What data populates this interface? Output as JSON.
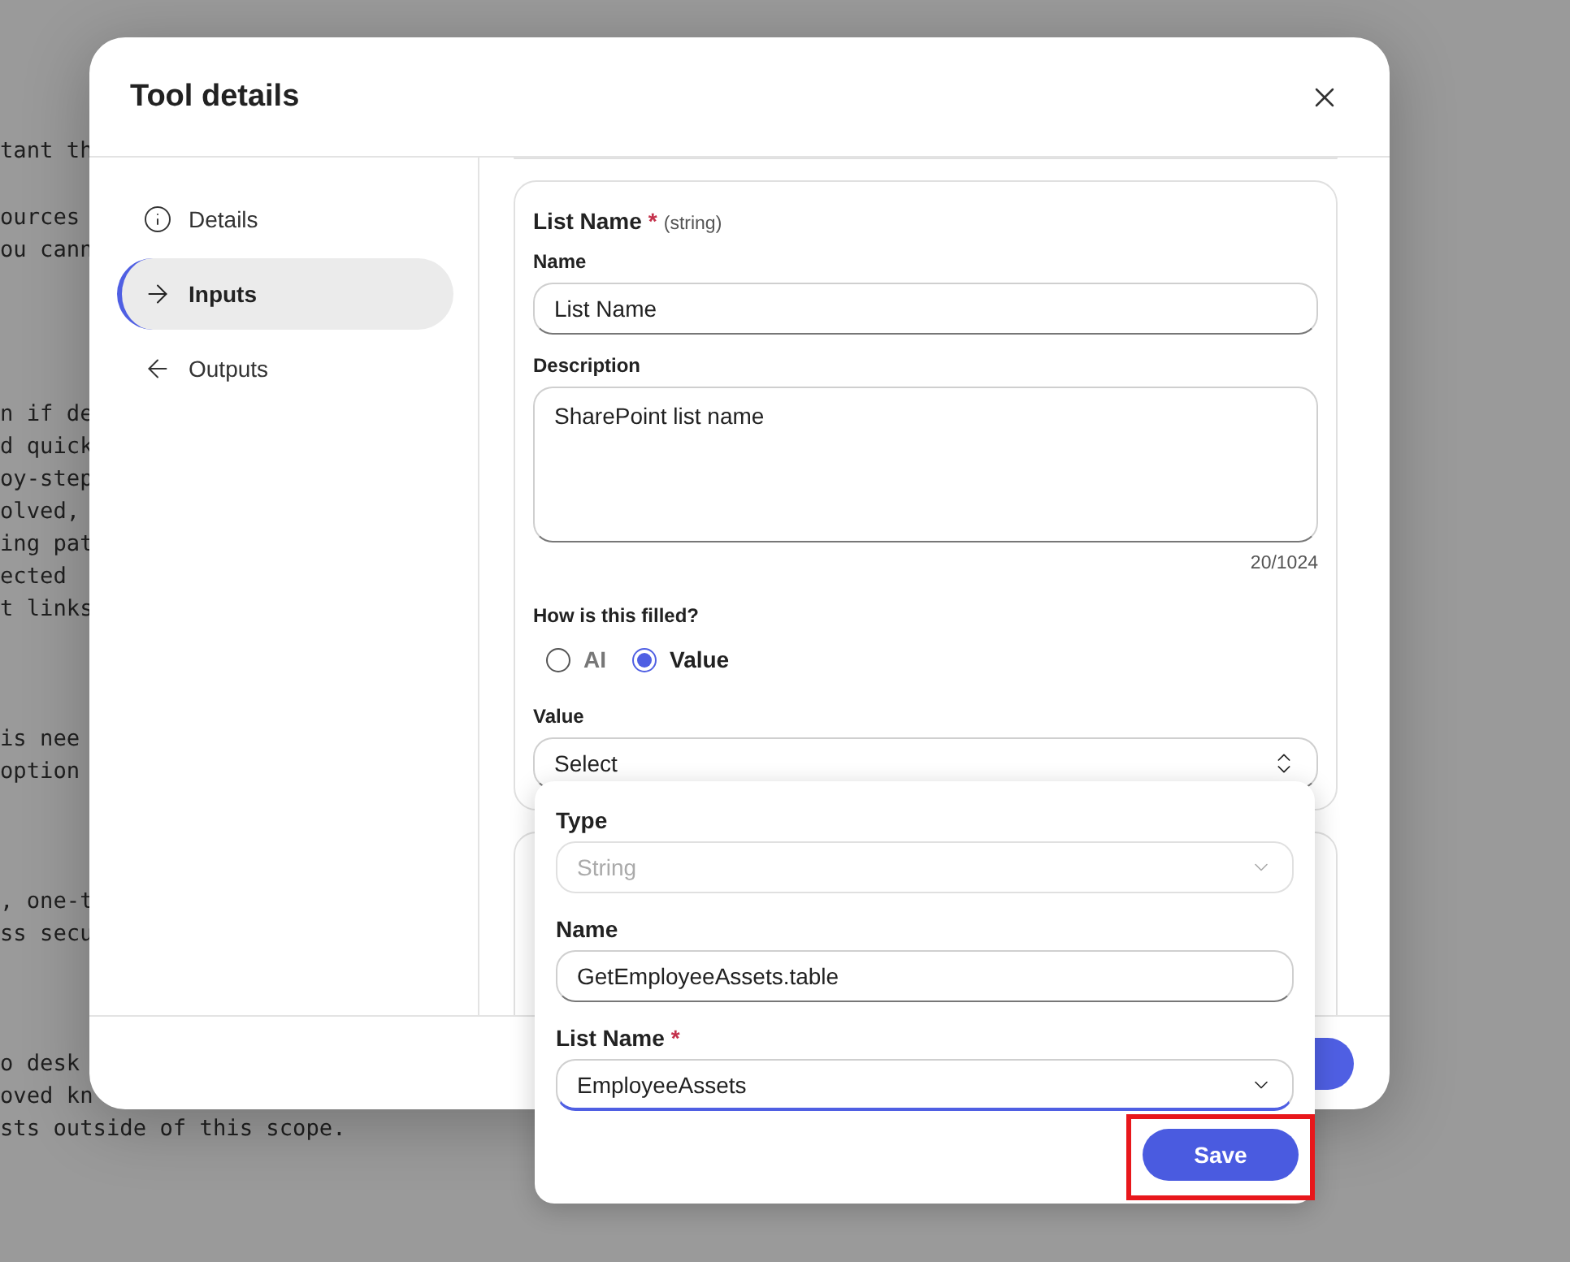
{
  "background_text": {
    "paragraphs": [
      [
        "tant th"
      ],
      [
        "ources",
        "ou cann"
      ],
      [
        "n if de",
        "d quick",
        "oy-step",
        "olved,",
        "ing pat",
        "ected",
        "t links"
      ],
      [
        "is nee",
        "option"
      ],
      [
        ", one-t",
        "ss secu"
      ],
      [
        "o desk",
        "oved kn",
        "sts outside of this scope."
      ]
    ]
  },
  "dialog": {
    "title": "Tool details",
    "sidebar": {
      "items": [
        {
          "kind": "info",
          "label": "Details",
          "selected": false
        },
        {
          "kind": "arrow-right",
          "label": "Inputs",
          "selected": true
        },
        {
          "kind": "arrow-left",
          "label": "Outputs",
          "selected": false
        }
      ]
    },
    "input_card": {
      "title": "List Name",
      "required_mark": "*",
      "type": "(string)",
      "name_label": "Name",
      "name_value": "List Name",
      "description_label": "Description",
      "description_value": "SharePoint list name",
      "counter": "20/1024",
      "fill_label": "How is this filled?",
      "fill_options": [
        {
          "label": "AI",
          "selected": false
        },
        {
          "label": "Value",
          "selected": true
        }
      ],
      "value_label": "Value",
      "value_select": "Select"
    }
  },
  "popover": {
    "type_label": "Type",
    "type_value": "String",
    "type_disabled": true,
    "name_label": "Name",
    "name_value": "GetEmployeeAssets.table",
    "list_label": "List Name",
    "list_required_mark": "*",
    "list_value": "EmployeeAssets",
    "list_focused": true,
    "save_label": "Save",
    "save_annotated": true
  }
}
